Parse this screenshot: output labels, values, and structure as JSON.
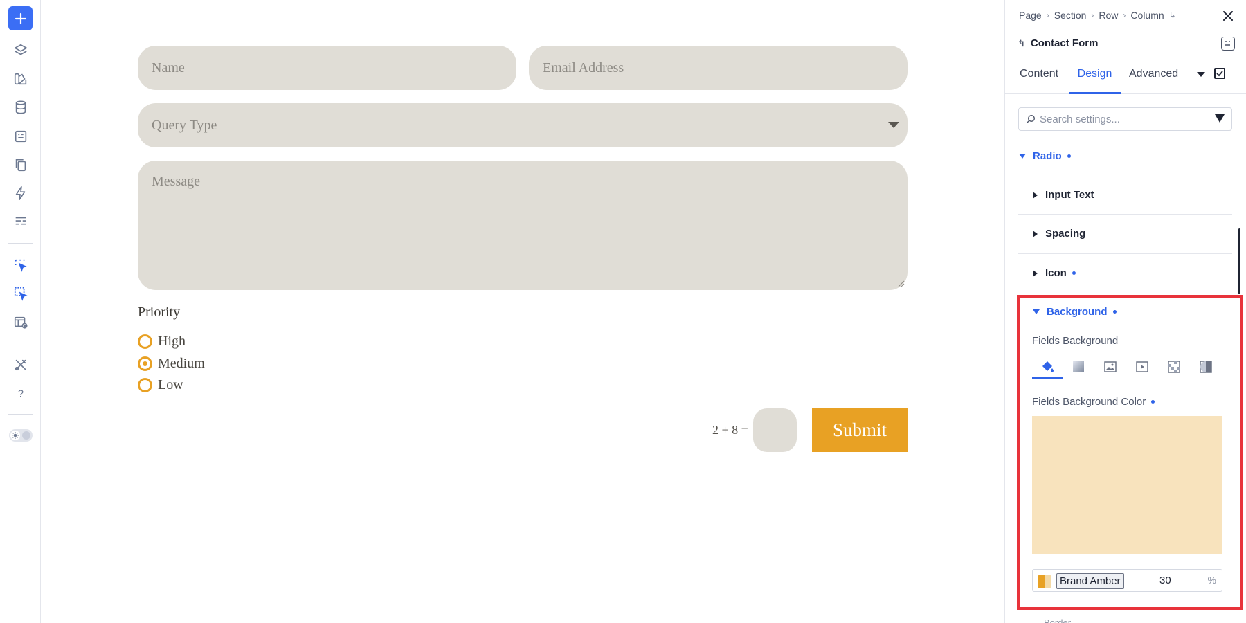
{
  "form": {
    "name_placeholder": "Name",
    "email_placeholder": "Email Address",
    "query_placeholder": "Query Type",
    "message_placeholder": "Message",
    "priority_label": "Priority",
    "priority_options": [
      {
        "label": "High",
        "selected": false
      },
      {
        "label": "Medium",
        "selected": true
      },
      {
        "label": "Low",
        "selected": false
      }
    ],
    "captcha_text": "2 + 8 =",
    "submit_label": "Submit"
  },
  "panel": {
    "breadcrumb": [
      "Page",
      "Section",
      "Row",
      "Column"
    ],
    "module_title": "Contact Form",
    "tabs": [
      "Content",
      "Design",
      "Advanced"
    ],
    "active_tab": "Design",
    "search_placeholder": "Search settings...",
    "sections": {
      "radio": "Radio",
      "input_text": "Input Text",
      "spacing": "Spacing",
      "icon": "Icon",
      "background": "Background"
    },
    "fields_background_label": "Fields Background",
    "fields_background_color_label": "Fields Background Color",
    "color_name": "Brand Amber",
    "opacity_value": "30",
    "opacity_unit": "%",
    "next_section_partial": "Border"
  },
  "colors": {
    "accent": "#2f63e8",
    "brand_amber": "#e8a124",
    "field_bg": "#e0ddd6",
    "preview": "#f8e3bd",
    "highlight": "#e8333b"
  }
}
